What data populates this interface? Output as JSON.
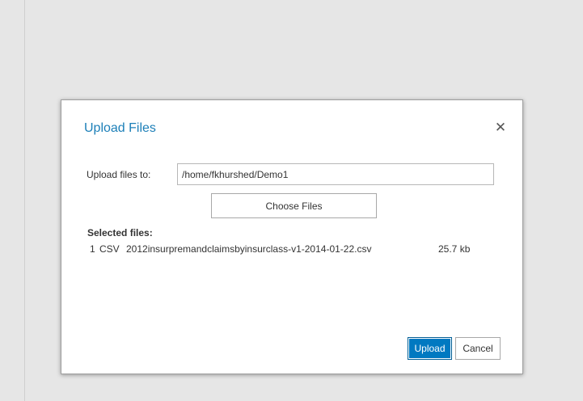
{
  "dialog": {
    "title": "Upload Files",
    "close_icon": "close-icon",
    "close_glyph": "✕",
    "upload_to_label": "Upload files to:",
    "upload_path": "/home/fkhurshed/Demo1",
    "choose_label": "Choose Files",
    "selected_heading": "Selected files:",
    "files": [
      {
        "index": "1",
        "type": "CSV",
        "name": "2012insurpremandclaimsbyinsurclass-v1-2014-01-22.csv",
        "size": "25.7 kb"
      }
    ],
    "upload_label": "Upload",
    "cancel_label": "Cancel"
  },
  "colors": {
    "accent": "#0079c1",
    "title": "#1c7fb8",
    "background": "#e6e6e6"
  }
}
